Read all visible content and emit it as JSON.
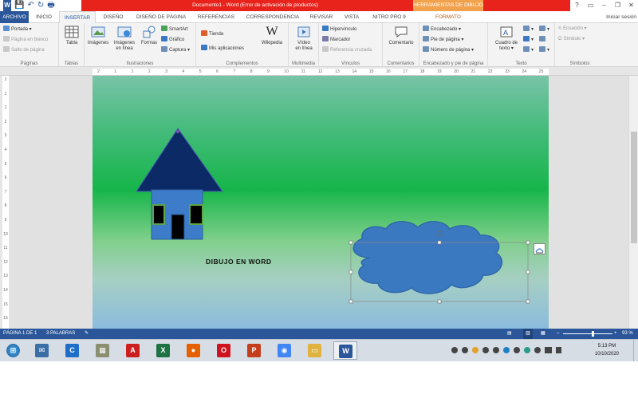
{
  "titlebar": {
    "document_title": "Documento1 - Word (Error de activación de productos)",
    "context_tab_title": "HERRAMIENTAS DE DIBUJO",
    "help_label": "?",
    "minimize_glyph": "–",
    "restore_glyph": "❐",
    "close_glyph": "✕",
    "qat_save": "💾",
    "qat_undo": "↶",
    "qat_redo": "↻",
    "qat_print": "🖶"
  },
  "tabs": {
    "file": "ARCHIVO",
    "home": "INICIO",
    "insert": "INSERTAR",
    "design": "DISEÑO",
    "page_layout": "DISEÑO DE PÁGINA",
    "references": "REFERENCIAS",
    "mailings": "CORRESPONDENCIA",
    "review": "REVISAR",
    "view": "VISTA",
    "nitro": "NITRO PRO 9",
    "format": "FORMATO",
    "sign_in": "Iniciar sesión"
  },
  "ribbon": {
    "paginas": {
      "label": "Páginas",
      "cover": "Portada ▾",
      "blank_page": "Página en blanco",
      "page_break": "Salto de página"
    },
    "tablas": {
      "label": "Tablas",
      "table": "Tabla"
    },
    "ilustraciones": {
      "label": "Ilustraciones",
      "images": "Imágenes",
      "online_images_1": "Imágenes",
      "online_images_2": "en línea",
      "shapes": "Formas",
      "smartart": "SmartArt",
      "chart": "Gráfico",
      "screenshot": "Captura ▾"
    },
    "complementos": {
      "label": "Complementos",
      "store": "Tienda",
      "my_apps": "Mis aplicaciones",
      "wikipedia": "Wikipedia",
      "wiki_glyph": "W"
    },
    "multimedia": {
      "label": "Multimedia",
      "video_1": "Vídeo",
      "video_2": "en línea"
    },
    "vinculos": {
      "label": "Vínculos",
      "hyperlink": "Hipervínculo",
      "bookmark": "Marcador",
      "cross_ref": "Referencia cruzada"
    },
    "comentarios": {
      "label": "Comentarios",
      "comment": "Comentario"
    },
    "encabezado": {
      "label": "Encabezado y pie de página",
      "header": "Encabezado ▾",
      "footer": "Pie de página ▾",
      "page_number": "Número de página ▾"
    },
    "texto": {
      "label": "Texto",
      "textbox_1": "Cuadro de",
      "textbox_2": "texto ▾"
    },
    "simbolos": {
      "label": "Símbolos",
      "equation": "Ecuación ▾",
      "symbol": "Símbolo ▾"
    }
  },
  "ruler": {
    "h_numbers": [
      "2",
      "1",
      "1",
      "2",
      "3",
      "4",
      "5",
      "6",
      "7",
      "8",
      "9",
      "10",
      "11",
      "12",
      "13",
      "14",
      "15",
      "16",
      "17",
      "18",
      "19",
      "20",
      "21",
      "22",
      "23",
      "24",
      "25"
    ],
    "v_numbers": [
      "2",
      "1",
      "1",
      "2",
      "3",
      "4",
      "5",
      "6",
      "7",
      "8",
      "9",
      "10",
      "11",
      "12",
      "13",
      "14",
      "15",
      "16"
    ]
  },
  "document": {
    "wordart_text": "DIBUJO EN WORD"
  },
  "colors": {
    "word_blue": "#2b579a",
    "title_red": "#e8231c",
    "context_orange": "#f2a24d",
    "roof_navy": "#0b2a66",
    "house_blue": "#3d7cc9",
    "cloud_blue": "#3a79c0",
    "window_green": "#5ea644"
  },
  "statusbar": {
    "page": "PÁGINA 1 DE 1",
    "words": "3 PALABRAS",
    "zoom": "93 %",
    "zoom_fraction": 0.6
  },
  "taskbar": {
    "start_glyph": "⊞",
    "apps": [
      {
        "name": "thunderbird",
        "glyph": "✉",
        "color": "#3a6ea5"
      },
      {
        "name": "ccleaner",
        "glyph": "C",
        "color": "#1f6fc8"
      },
      {
        "name": "archive",
        "glyph": "▦",
        "color": "#8a8f70"
      },
      {
        "name": "acrobat",
        "glyph": "A",
        "color": "#cc2020"
      },
      {
        "name": "excel",
        "glyph": "X",
        "color": "#1f7244"
      },
      {
        "name": "firefox",
        "glyph": "●",
        "color": "#e66000"
      },
      {
        "name": "opera",
        "glyph": "O",
        "color": "#d0141f"
      },
      {
        "name": "powerpoint",
        "glyph": "P",
        "color": "#c43e1c"
      },
      {
        "name": "chrome",
        "glyph": "◉",
        "color": "#4285f4"
      },
      {
        "name": "file-explorer",
        "glyph": "▭",
        "color": "#e0b341"
      },
      {
        "name": "word",
        "glyph": "W",
        "color": "#2b579a"
      }
    ],
    "time": "5:13 PM",
    "date": "10/10/2020"
  }
}
